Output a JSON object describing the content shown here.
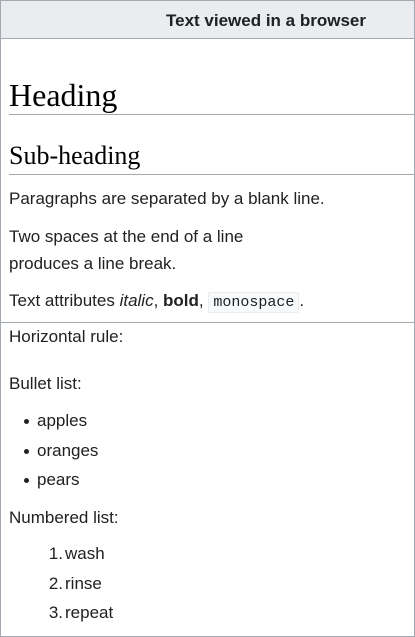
{
  "window": {
    "title": "Text viewed in a browser"
  },
  "document": {
    "heading": "Heading",
    "subheading": "Sub-heading",
    "para_blank_line": "Paragraphs are separated by a blank line.",
    "para_break_line1": "Two spaces at the end of a line",
    "para_break_line2": "produces a line break.",
    "attributes": {
      "prefix": "Text attributes ",
      "italic": "italic",
      "sep1": ", ",
      "bold": "bold",
      "sep2": ", ",
      "monospace": "monospace",
      "suffix": "."
    },
    "horizontal_rule_label": "Horizontal rule:",
    "bullet_list_label": "Bullet list:",
    "bullet_items": [
      "apples",
      "oranges",
      "pears"
    ],
    "numbered_list_label": "Numbered list:",
    "numbered_items": [
      {
        "num": "1.",
        "text": "wash"
      },
      {
        "num": "2.",
        "text": "rinse"
      },
      {
        "num": "3.",
        "text": "repeat"
      }
    ]
  },
  "colors": {
    "titlebar_bg": "#eaecf0",
    "border": "#a2a9b1",
    "text": "#202122"
  }
}
